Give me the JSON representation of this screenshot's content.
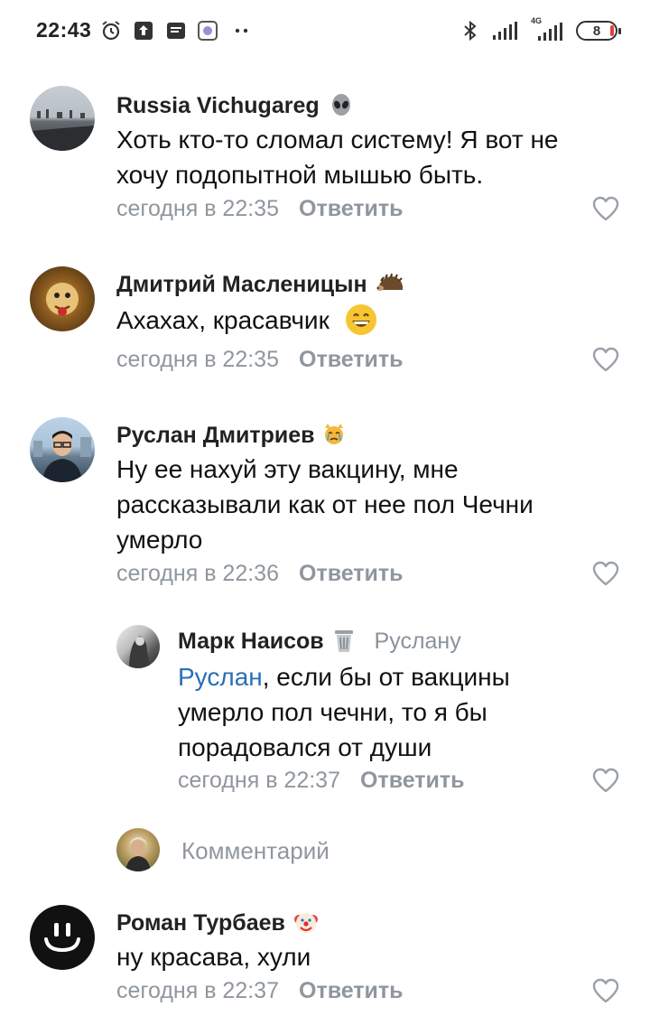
{
  "status_bar": {
    "time": "22:43",
    "battery": "8",
    "network_label": "4G"
  },
  "comments": [
    {
      "author": "Russia Vichugareg",
      "author_badge": "alien-emoji",
      "text": "Хоть кто-то сломал систему! Я вот не хочу подопытной мышью быть.",
      "time": "сегодня в 22:35",
      "reply_label": "Ответить"
    },
    {
      "author": "Дмитрий Масленицын",
      "author_badge": "hedgehog-emoji",
      "text": "Ахахах, красавчик",
      "text_emoji": "grinning-emoji",
      "time": "сегодня в 22:35",
      "reply_label": "Ответить"
    },
    {
      "author": "Руслан Дмитриев",
      "author_badge": "crying-cat-emoji",
      "text": "Ну ее нахуй эту вакцину, мне рассказывали как от нее пол Чечни умерло",
      "time": "сегодня в 22:36",
      "reply_label": "Ответить"
    },
    {
      "author": "Марк Наисов",
      "author_badge": "wastebasket-emoji",
      "reply_to": "Руслану",
      "mention": "Руслан",
      "text": ", если бы от вакцины умерло пол чечни, то я бы порадовался от души",
      "time": "сегодня в 22:37",
      "reply_label": "Ответить"
    },
    {
      "author": "Роман Турбаев",
      "author_badge": "clown-emoji",
      "text": "ну красава, хули",
      "time": "сегодня в 22:37",
      "reply_label": "Ответить"
    }
  ],
  "comment_input": {
    "placeholder": "Комментарий"
  },
  "colors": {
    "meta_gray": "#8f969e",
    "mention_blue": "#2a6fb6",
    "text": "#111111"
  }
}
